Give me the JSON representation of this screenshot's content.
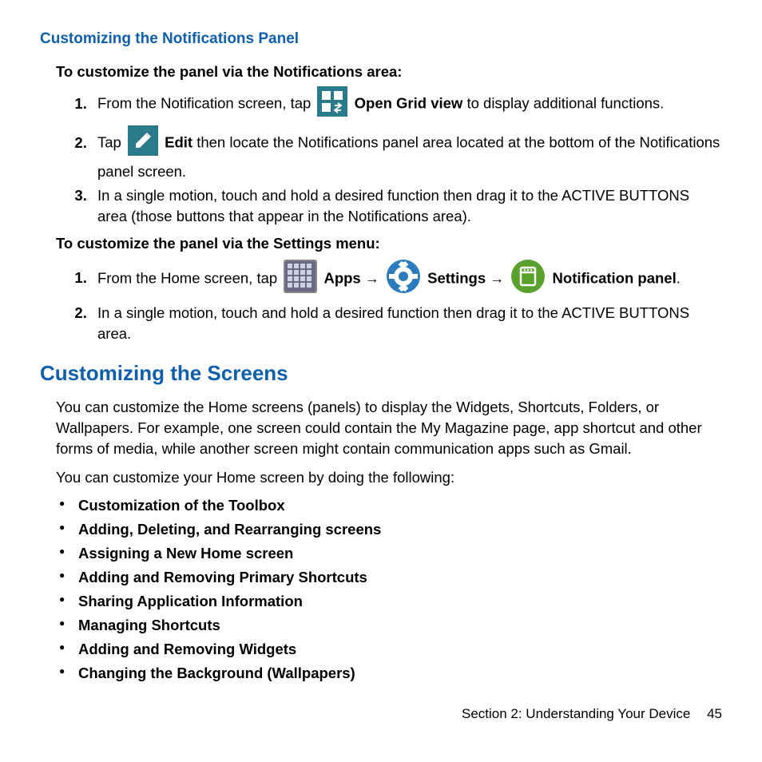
{
  "section1": {
    "heading": "Customizing the Notifications Panel",
    "sub1": "To customize the panel via the Notifications area:",
    "step1a": "From the Notification screen, tap ",
    "step1b": " to display additional functions.",
    "openGrid": "Open Grid view",
    "step2a": "Tap ",
    "editLabel": "Edit",
    "step2b": " then locate the Notifications panel area located at the bottom of the Notifications panel screen.",
    "step3": "In a single motion, touch and hold a desired function then drag it to the ACTIVE BUTTONS area (those buttons that appear in the Notifications area).",
    "sub2": "To customize the panel via the Settings menu:",
    "s2step1a": "From the Home screen, tap ",
    "apps": "Apps",
    "arrow": "→",
    "settings": "Settings",
    "notifPanel1": "Notification panel",
    "period": ".",
    "s2step2": "In a single motion, touch and hold a desired function then drag it to the ACTIVE BUTTONS area."
  },
  "section2": {
    "heading": "Customizing the Screens",
    "p1": "You can customize the Home screens (panels) to display the Widgets, Shortcuts, Folders, or Wallpapers. For example, one screen could contain the My Magazine page, app shortcut and other forms of media, while another screen might contain communication apps such as Gmail.",
    "p2": "You can customize your Home screen by doing the following:",
    "bullets": [
      "Customization of the Toolbox",
      "Adding, Deleting, and Rearranging screens",
      "Assigning a New Home screen",
      "Adding and Removing Primary Shortcuts",
      "Sharing Application Information",
      "Managing Shortcuts",
      "Adding and Removing Widgets",
      "Changing the Background (Wallpapers)"
    ]
  },
  "footer": {
    "section": "Section 2:  Understanding Your Device",
    "page": "45"
  }
}
